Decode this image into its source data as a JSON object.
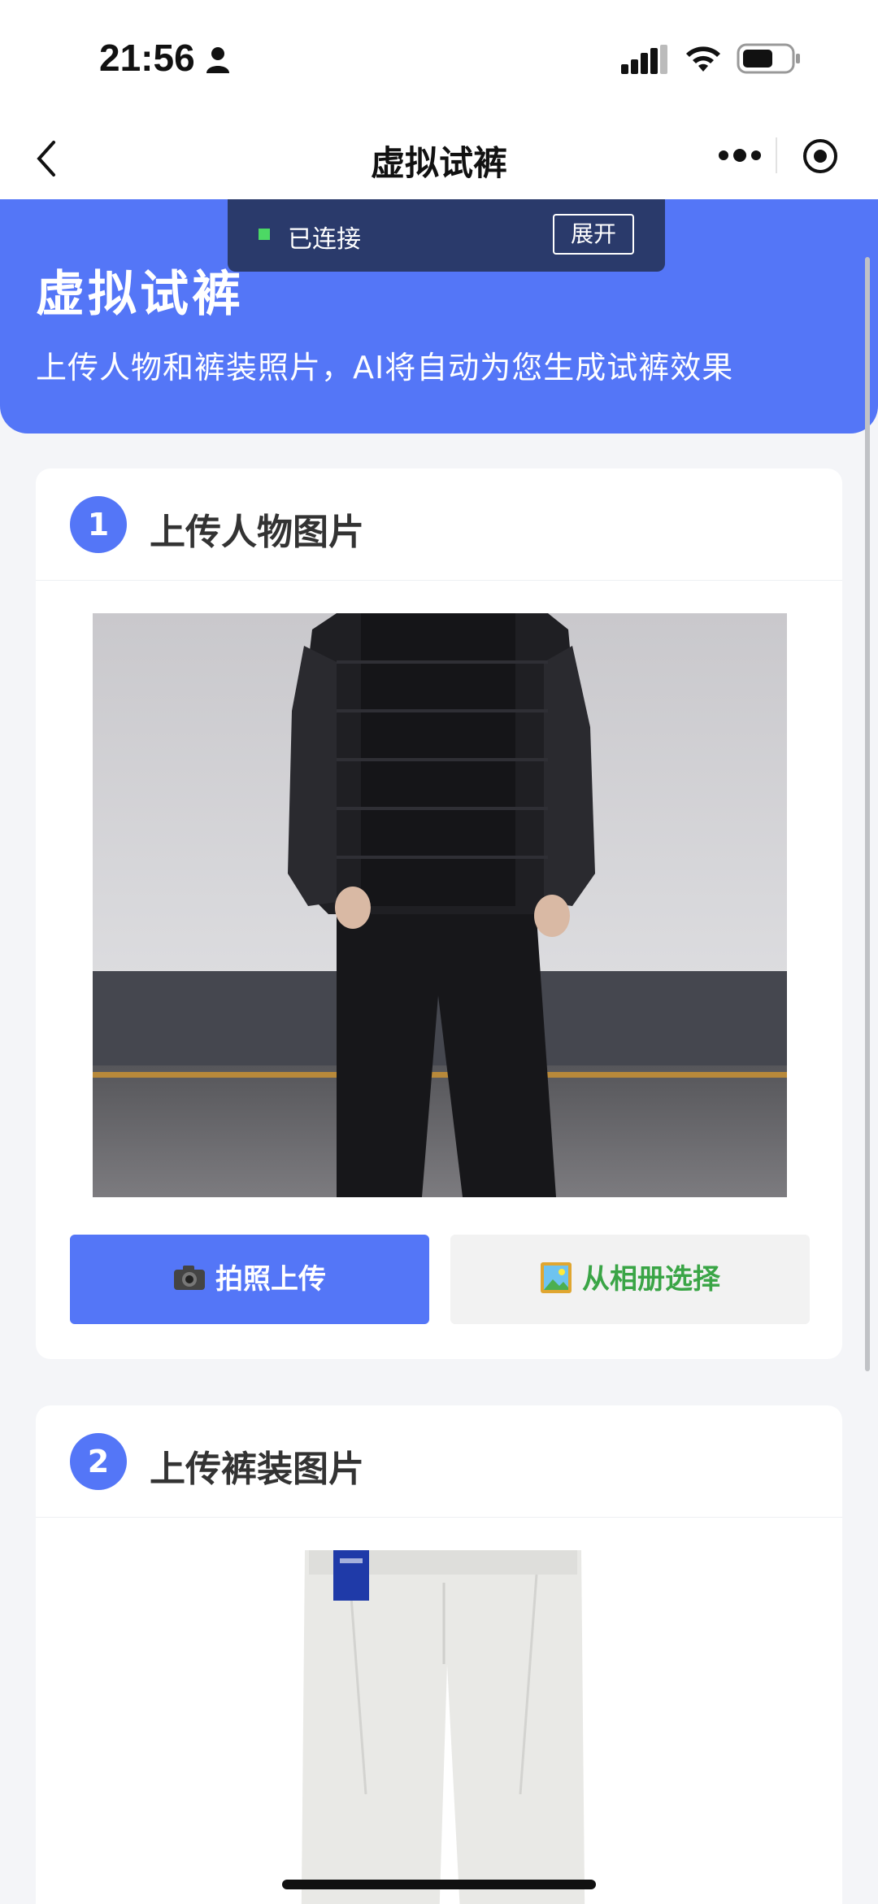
{
  "status_bar": {
    "time": "21:56"
  },
  "nav": {
    "title": "虚拟试裤"
  },
  "connection": {
    "status": "已连接",
    "expand_label": "展开",
    "status_color": "#4cd964"
  },
  "hero": {
    "title": "虚拟试裤",
    "subtitle": "上传人物和裤装照片，AI将自动为您生成试裤效果"
  },
  "step1": {
    "number": "1",
    "title": "上传人物图片",
    "camera_button": {
      "icon": "camera-icon",
      "label": "拍照上传"
    },
    "album_button": {
      "icon": "picture-icon",
      "label": "从相册选择"
    }
  },
  "step2": {
    "number": "2",
    "title": "上传裤装图片"
  },
  "colors": {
    "accent": "#5476f7",
    "album_text": "#3aa546",
    "banner": "#2a3a6b"
  }
}
